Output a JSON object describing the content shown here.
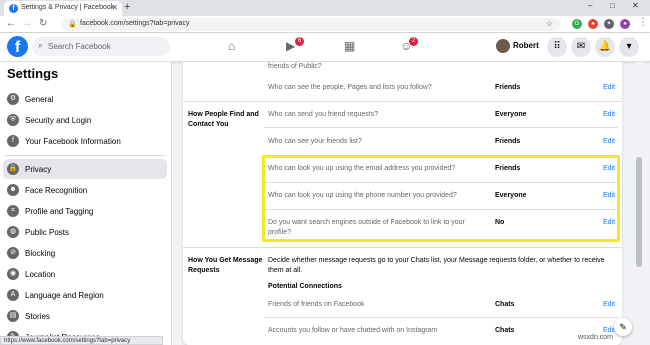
{
  "browser": {
    "tab_title": "Settings & Privacy | Facebook",
    "tab_favicon": "f",
    "new_tab_icon": "+",
    "url": "facebook.com/settings?tab=privacy",
    "window_controls": [
      "–",
      "□",
      "✕"
    ],
    "status_url": "https://www.facebook.com/settings?tab=privacy"
  },
  "header": {
    "logo": "f",
    "search_placeholder": "Search Facebook",
    "watch_badge": "6",
    "groups_badge": "2",
    "profile_name": "Robert"
  },
  "sidebar": {
    "title": "Settings",
    "items": [
      {
        "label": "General",
        "icon": "gear-icon"
      },
      {
        "label": "Security and Login",
        "icon": "shield-icon"
      },
      {
        "label": "Your Facebook Information",
        "icon": "facebook-icon"
      },
      {
        "label": "Privacy",
        "icon": "lock-icon"
      },
      {
        "label": "Face Recognition",
        "icon": "face-icon"
      },
      {
        "label": "Profile and Tagging",
        "icon": "tag-icon"
      },
      {
        "label": "Public Posts",
        "icon": "globe-icon"
      },
      {
        "label": "Blocking",
        "icon": "block-icon"
      },
      {
        "label": "Location",
        "icon": "location-icon"
      },
      {
        "label": "Language and Region",
        "icon": "language-icon"
      },
      {
        "label": "Stories",
        "icon": "stories-icon"
      },
      {
        "label": "Journalist Resources",
        "icon": "journalist-icon"
      }
    ]
  },
  "main": {
    "partial_top_text": "friends of Public?",
    "rows_top": [
      {
        "question": "Who can see the people, Pages and lists you follow?",
        "value": "Friends",
        "edit": "Edit"
      }
    ],
    "find_section": {
      "heading": "How People Find and Contact You",
      "rows": [
        {
          "question": "Who can send you friend requests?",
          "value": "Everyone",
          "edit": "Edit"
        },
        {
          "question": "Who can see your friends list?",
          "value": "Friends",
          "edit": "Edit"
        },
        {
          "question": "Who can look you up using the email address you provided?",
          "value": "Friends",
          "edit": "Edit"
        },
        {
          "question": "Who can look you up using the phone number you provided?",
          "value": "Everyone",
          "edit": "Edit"
        },
        {
          "question": "Do you want search engines outside of Facebook to link to your profile?",
          "value": "No",
          "edit": "Edit"
        }
      ]
    },
    "message_section": {
      "heading": "How You Get Message Requests",
      "description": "Decide whether message requests go to your Chats list, your Message requests folder, or whether to receive them at all.",
      "subheading": "Potential Connections",
      "rows": [
        {
          "question": "Friends of friends on Facebook",
          "value": "Chats",
          "edit": "Edit"
        },
        {
          "question": "Accounts you follow or have chatted with on Instagram",
          "value": "Chats",
          "edit": "Edit"
        }
      ]
    }
  },
  "watermark": "wsxdn.com",
  "highlight_color": "#f7e629",
  "accent": "#1877f2"
}
